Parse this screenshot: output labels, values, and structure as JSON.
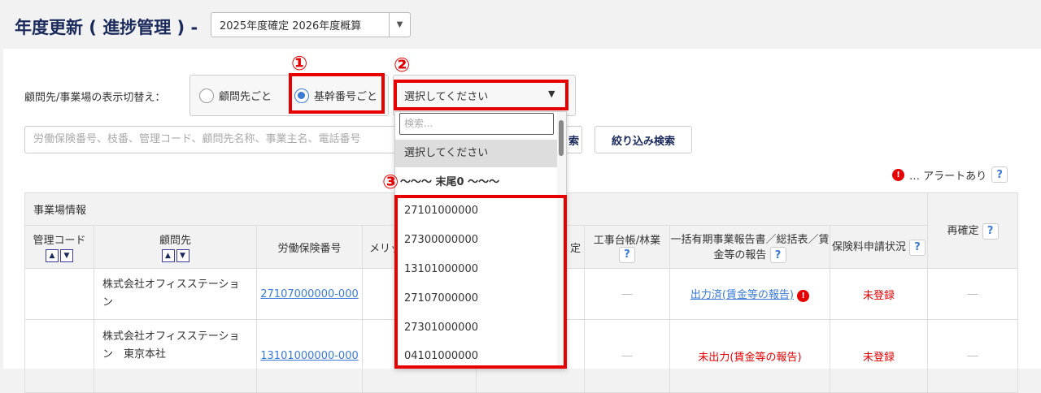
{
  "header": {
    "title": "年度更新 ( 進捗管理 ) -",
    "year_select": "2025年度確定 2026年度概算"
  },
  "filter": {
    "label": "顧問先/事業場の表示切替え：",
    "radio_client": "顧問先ごと",
    "radio_base": "基幹番号ごと",
    "select_value": "選択してください",
    "select_arrow": "▼"
  },
  "search": {
    "placeholder": "労働保険番号、枝番、管理コード、顧問先名称、事業主名、電話番号",
    "search_btn_partial": "索",
    "filter_btn": "絞り込み検索"
  },
  "annotations": {
    "n1": "①",
    "n2": "②",
    "n3": "③"
  },
  "dropdown": {
    "search_placeholder": "検索...",
    "items": [
      "選択してください",
      "〜〜〜 末尾0 〜〜〜",
      "27101000000",
      "27300000000",
      "13101000000",
      "27107000000",
      "27301000000",
      "04101000000"
    ]
  },
  "legend": {
    "alert_icon": "!",
    "text": "… アラートあり",
    "help": "?"
  },
  "table": {
    "group_header": "事業場情報",
    "reconfirm": "再確定",
    "help": "?",
    "columns": [
      "管理コード",
      "顧問先",
      "労働保険番号",
      "メリット",
      "定",
      "工事台帳/林業",
      "一括有期事業報告書／総括表／賃金等の報告",
      "保険料申請状況"
    ],
    "sort_up": "^",
    "sort_down": "v",
    "rows": [
      {
        "client": "株式会社オフィスステーション",
        "number": "27107000000-000",
        "construction": "―",
        "report": "出力済(賃金等の報告)",
        "report_alert": "!",
        "status": "未登録",
        "reconfirm": "―"
      },
      {
        "client": "株式会社オフィスステーション　東京本社",
        "number": "13101000000-000",
        "construction": "―",
        "report": "未出力(賃金等の報告)",
        "status": "未登録",
        "reconfirm": "―"
      }
    ]
  },
  "colors": {
    "accent": "#3a7bd5",
    "annotation": "#e60000",
    "title": "#1a2a5a"
  }
}
